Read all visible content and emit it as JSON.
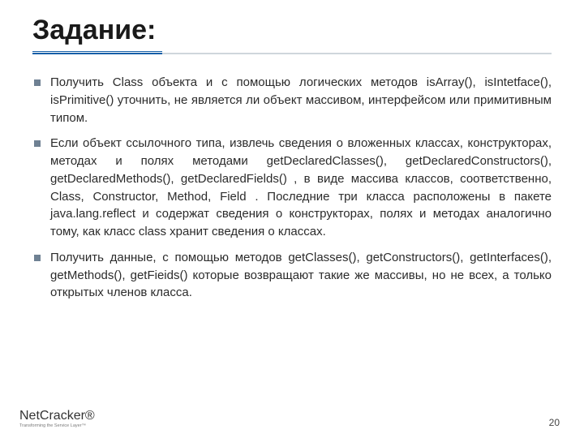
{
  "title": "Задание:",
  "bullets": [
    "Получить Class объекта и с помощью логических методов isArray(), isIntetface(), isPrimitive() уточнить, не является ли объект массивом, интерфейсом или примитивным типом.",
    "Если объект ссылочного типа, извлечь сведения о вложенных классах, конструкторах, методах и полях методами getDeclaredClasses(), getDeclaredConstructors(), getDeclaredMethods(), getDeclaredFields() , в виде массива классов, соответственно, Class, Constructor, Method, Field . Последние три класса расположены в пакете java.lang.reflect и содержат сведения о конструкторах, полях и методах аналогично тому, как класс class хранит сведения о классах.",
    "Получить данные, с помощью методов getClasses(), getConstructors(), getInterfaces(), getMethods(), getFieids() которые возвращают такие же массивы, но не всех, а только открытых членов класса."
  ],
  "logo": {
    "part1": "Net",
    "part2": "Cracker",
    "reg": "®",
    "tagline": "Transforming the Service Layer™"
  },
  "page_number": "20"
}
